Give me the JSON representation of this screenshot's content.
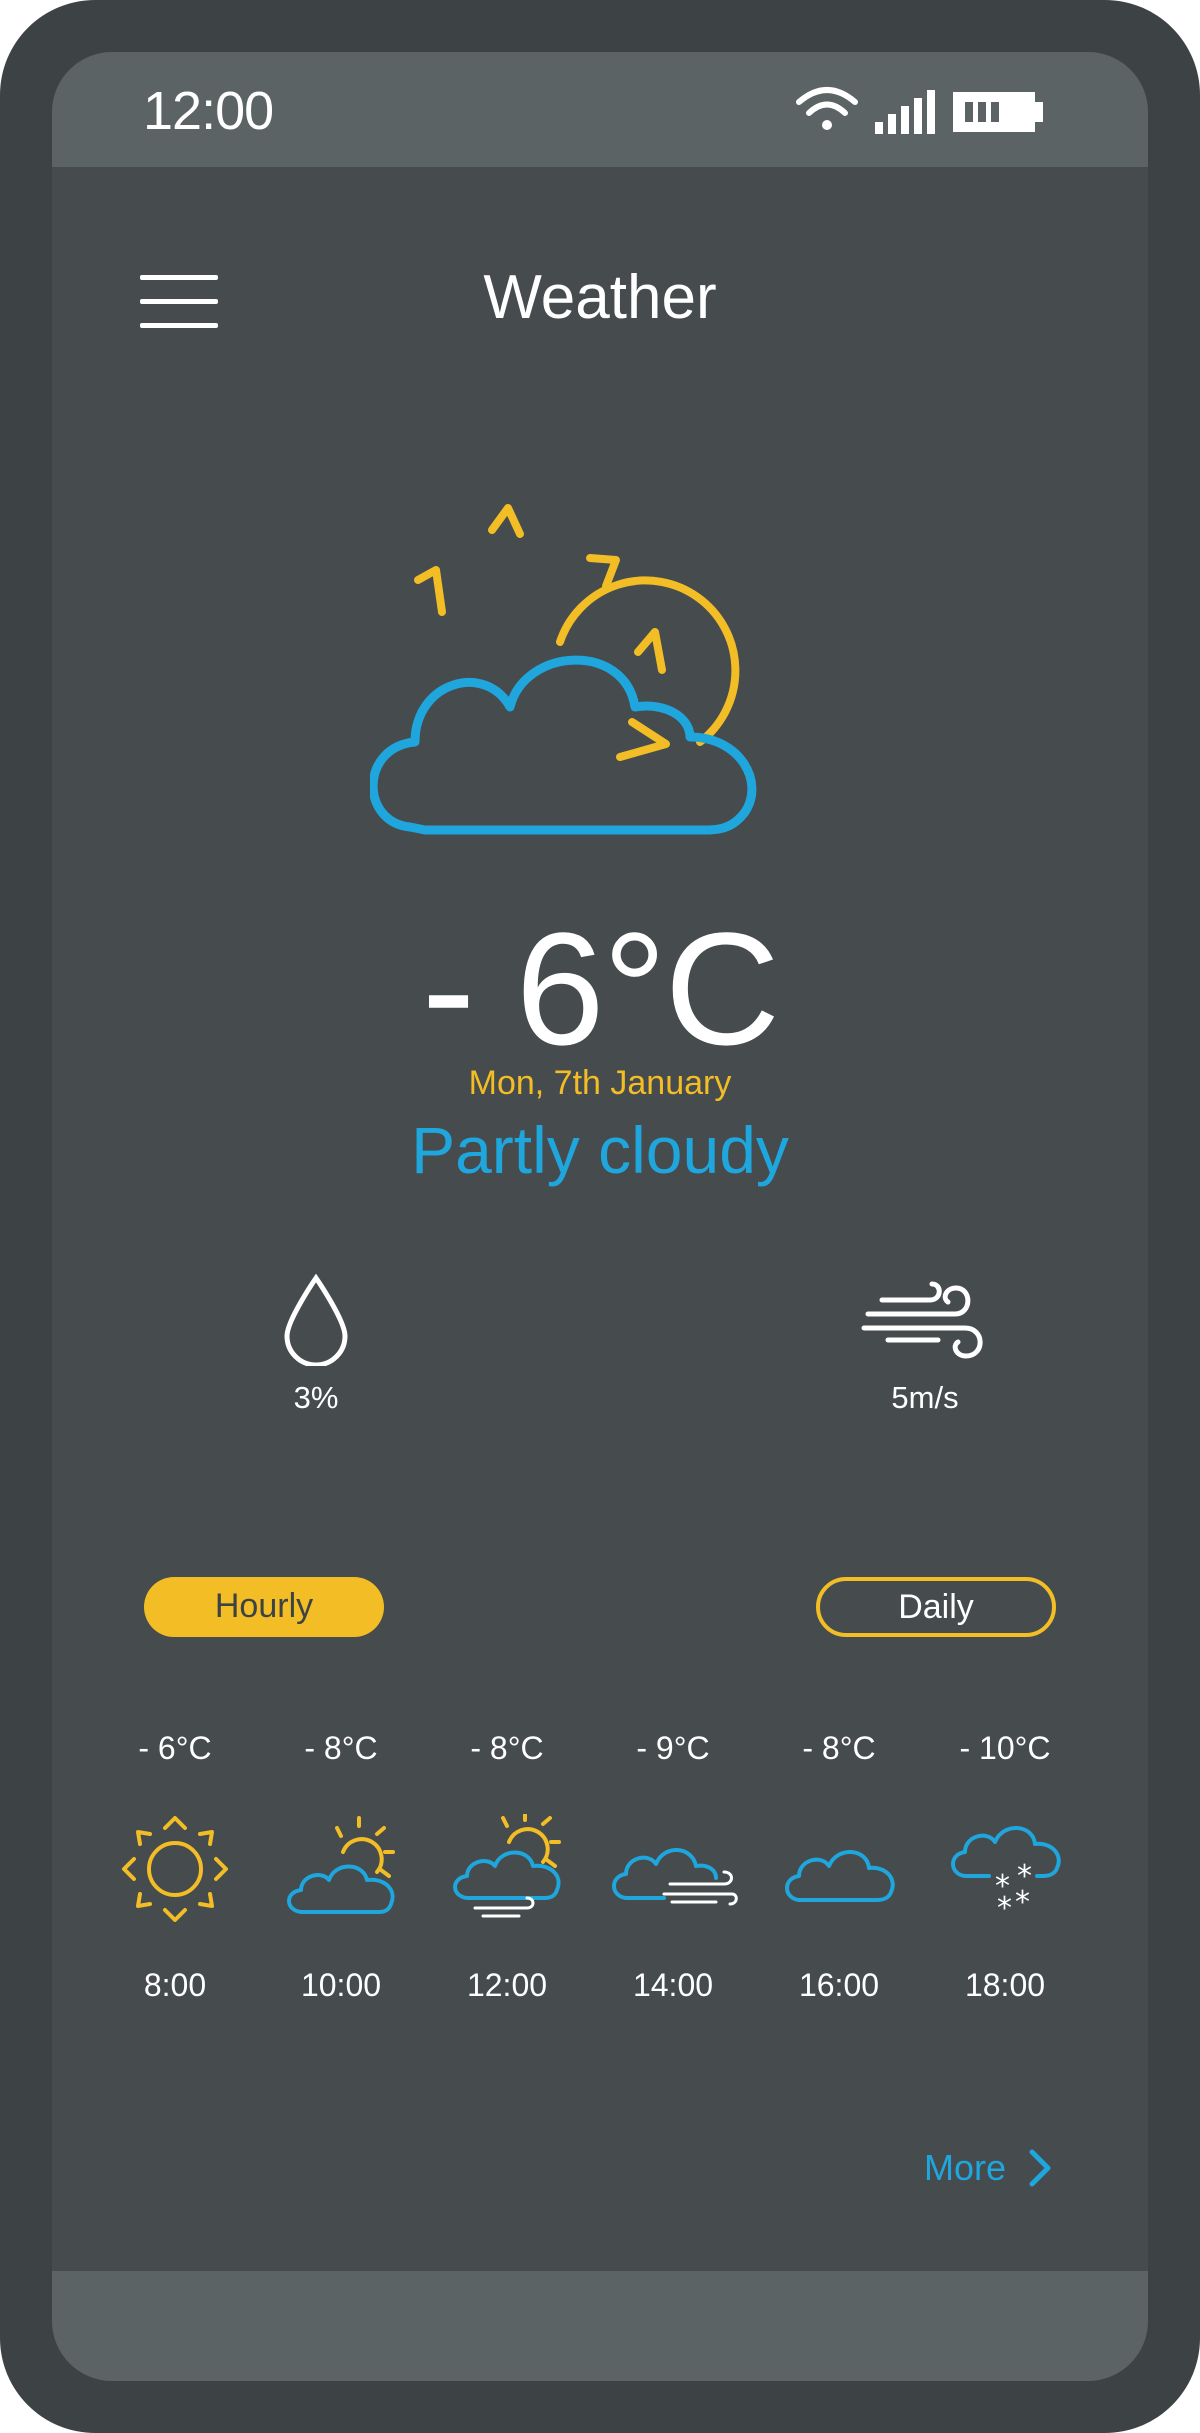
{
  "status_bar": {
    "time": "12:00",
    "icons": [
      "wifi-icon",
      "signal-icon",
      "battery-icon"
    ]
  },
  "header": {
    "title": "Weather",
    "menu_icon": "hamburger-menu-icon"
  },
  "current": {
    "icon": "partly-cloudy-icon",
    "temperature": "- 6°C",
    "date": "Mon, 7th January",
    "condition": "Partly cloudy"
  },
  "stats": {
    "humidity": {
      "icon": "droplet-icon",
      "value": "3%"
    },
    "wind": {
      "icon": "wind-icon",
      "value": "5m/s"
    }
  },
  "tabs": {
    "hourly": {
      "label": "Hourly",
      "active": true
    },
    "daily": {
      "label": "Daily",
      "active": false
    }
  },
  "hourly": [
    {
      "temp": "- 6°C",
      "icon": "sun-icon",
      "time": "8:00"
    },
    {
      "temp": "- 8°C",
      "icon": "sun-behind-cloud-icon",
      "time": "10:00"
    },
    {
      "temp": "- 8°C",
      "icon": "sun-cloud-wind-icon",
      "time": "12:00"
    },
    {
      "temp": "- 9°C",
      "icon": "cloud-wind-icon",
      "time": "14:00"
    },
    {
      "temp": "- 8°C",
      "icon": "cloud-icon",
      "time": "16:00"
    },
    {
      "temp": "- 10°C",
      "icon": "cloud-snow-icon",
      "time": "18:00"
    }
  ],
  "more": {
    "label": "More",
    "icon": "chevron-right-icon"
  },
  "colors": {
    "accent_yellow": "#f2bd25",
    "accent_blue": "#1ea6dd",
    "background": "#464b4e",
    "frame": "#3d4244",
    "bar": "#5c6365"
  }
}
